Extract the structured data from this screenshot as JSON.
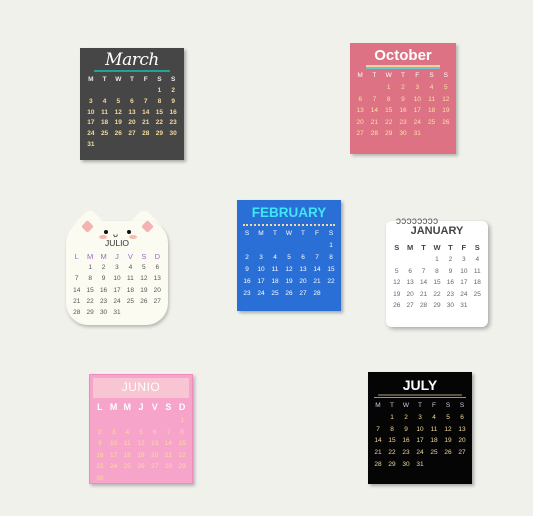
{
  "calendars": {
    "march": {
      "title": "March",
      "weekdays": [
        "M",
        "T",
        "W",
        "T",
        "F",
        "S",
        "S"
      ],
      "days": [
        "",
        "",
        "",
        "",
        "",
        "1",
        "2",
        "3",
        "4",
        "5",
        "6",
        "7",
        "8",
        "9",
        "10",
        "11",
        "12",
        "13",
        "14",
        "15",
        "16",
        "17",
        "18",
        "19",
        "20",
        "21",
        "22",
        "23",
        "24",
        "25",
        "26",
        "27",
        "28",
        "29",
        "30",
        "31",
        "",
        "",
        "",
        "",
        "",
        ""
      ]
    },
    "october": {
      "title": "October",
      "weekdays": [
        "M",
        "T",
        "W",
        "T",
        "F",
        "S",
        "S"
      ],
      "days": [
        "",
        "",
        "1",
        "2",
        "3",
        "4",
        "5",
        "6",
        "7",
        "8",
        "9",
        "10",
        "11",
        "12",
        "13",
        "14",
        "15",
        "16",
        "17",
        "18",
        "19",
        "20",
        "21",
        "22",
        "23",
        "24",
        "25",
        "26",
        "27",
        "28",
        "29",
        "30",
        "31",
        "",
        "",
        "",
        ""
      ]
    },
    "julio": {
      "title": "JULIO",
      "weekdays": [
        "L",
        "M",
        "M",
        "J",
        "V",
        "S",
        "D"
      ],
      "days": [
        "",
        "1",
        "2",
        "3",
        "4",
        "5",
        "6",
        "7",
        "8",
        "9",
        "10",
        "11",
        "12",
        "13",
        "14",
        "15",
        "16",
        "17",
        "18",
        "19",
        "20",
        "21",
        "22",
        "23",
        "24",
        "25",
        "26",
        "27",
        "28",
        "29",
        "30",
        "31",
        "",
        "",
        ""
      ]
    },
    "february": {
      "title": "FEBRUARY",
      "weekdays": [
        "S",
        "M",
        "T",
        "W",
        "T",
        "F",
        "S"
      ],
      "days": [
        "",
        "",
        "",
        "",
        "",
        "",
        "1",
        "2",
        "3",
        "4",
        "5",
        "6",
        "7",
        "8",
        "9",
        "10",
        "11",
        "12",
        "13",
        "14",
        "15",
        "16",
        "17",
        "18",
        "19",
        "20",
        "21",
        "22",
        "23",
        "24",
        "25",
        "26",
        "27",
        "28",
        ""
      ]
    },
    "january": {
      "title": "JANUARY",
      "weekdays": [
        "S",
        "M",
        "T",
        "W",
        "T",
        "F",
        "S"
      ],
      "days": [
        "",
        "",
        "",
        "1",
        "2",
        "3",
        "4",
        "5",
        "6",
        "7",
        "8",
        "9",
        "10",
        "11",
        "12",
        "13",
        "14",
        "15",
        "16",
        "17",
        "18",
        "19",
        "20",
        "21",
        "22",
        "23",
        "24",
        "25",
        "26",
        "27",
        "28",
        "29",
        "30",
        "31",
        ""
      ]
    },
    "junio": {
      "title": "JUNIO",
      "weekdays": [
        "L",
        "M",
        "M",
        "J",
        "V",
        "S",
        "D"
      ],
      "days": [
        "",
        "",
        "",
        "",
        "",
        "",
        "1",
        "2",
        "3",
        "4",
        "5",
        "6",
        "7",
        "8",
        "9",
        "10",
        "11",
        "12",
        "13",
        "14",
        "15",
        "16",
        "17",
        "18",
        "19",
        "20",
        "21",
        "22",
        "23",
        "24",
        "25",
        "26",
        "27",
        "28",
        "29",
        "30",
        "",
        "",
        "",
        "",
        "",
        ""
      ]
    },
    "july": {
      "title": "JULY",
      "weekdays": [
        "M",
        "T",
        "W",
        "T",
        "F",
        "S",
        "S"
      ],
      "days": [
        "",
        "1",
        "2",
        "3",
        "4",
        "5",
        "6",
        "7",
        "8",
        "9",
        "10",
        "11",
        "12",
        "13",
        "14",
        "15",
        "16",
        "17",
        "18",
        "19",
        "20",
        "21",
        "22",
        "23",
        "24",
        "25",
        "26",
        "27",
        "28",
        "29",
        "30",
        "31",
        "",
        "",
        ""
      ]
    }
  },
  "decor": {
    "january_rings": "ↄↄↄↄↄↄↄↄ",
    "cat_mouth": "ᴗ"
  }
}
